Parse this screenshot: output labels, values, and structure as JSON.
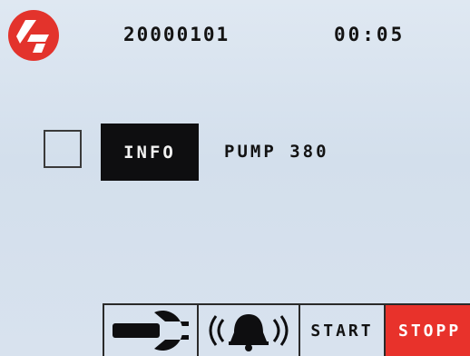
{
  "header": {
    "logo_icon": "brand-logo-icon",
    "date": "20000101",
    "time": "00:05"
  },
  "main": {
    "checkbox_checked": false,
    "info_button_label": "INFO",
    "pump_label": "PUMP 380"
  },
  "toolbar": {
    "settings_icon": "wrench-icon",
    "alarm_icon": "alarm-bell-icon",
    "start_label": "START",
    "stop_label": "STOPP"
  },
  "colors": {
    "background": "#d7e2ee",
    "logo_red": "#e3332c",
    "info_button_bg": "#0e0e10",
    "stop_button_bg": "#e8322b",
    "text": "#131313"
  }
}
